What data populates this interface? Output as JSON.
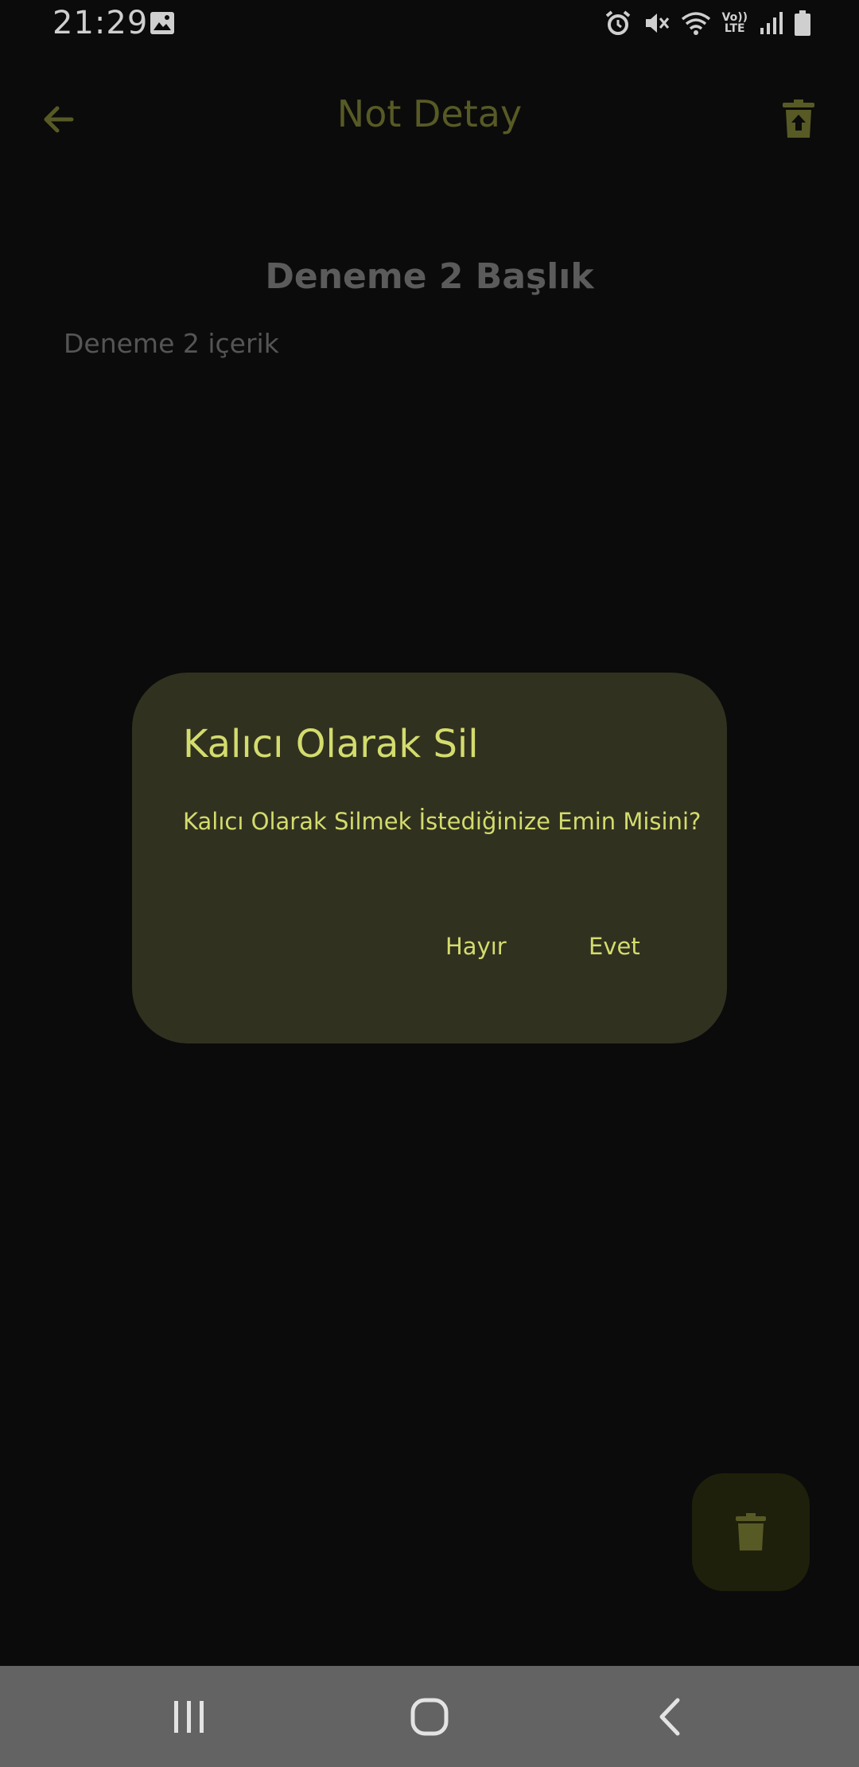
{
  "status_bar": {
    "time": "21:29",
    "icons": [
      "gallery-icon",
      "alarm-icon",
      "mute-icon",
      "wifi-icon",
      "volte-icon",
      "signal-icon",
      "battery-icon"
    ],
    "volte_top": "Vo))",
    "volte_bottom": "LTE"
  },
  "app_bar": {
    "title": "Not Detay",
    "back_icon": "arrow-left-icon",
    "action_icon": "trash-restore-icon"
  },
  "note": {
    "title": "Deneme 2 Başlık",
    "content": "Deneme 2 içerik"
  },
  "dialog": {
    "title": "Kalıcı Olarak Sil",
    "message": "Kalıcı Olarak Silmek İstediğinize Emin Misini?",
    "negative_label": "Hayır",
    "positive_label": "Evet"
  },
  "fab": {
    "icon": "trash-icon"
  },
  "nav_bar": {
    "icons": [
      "recents-icon",
      "home-icon",
      "back-icon"
    ]
  },
  "colors": {
    "background": "#0b0b0b",
    "accent_dim": "#575a25",
    "dialog_bg": "#313120",
    "dialog_text": "#d3dc6d",
    "fab_bg": "#1f200b",
    "nav_bar": "#636363"
  }
}
